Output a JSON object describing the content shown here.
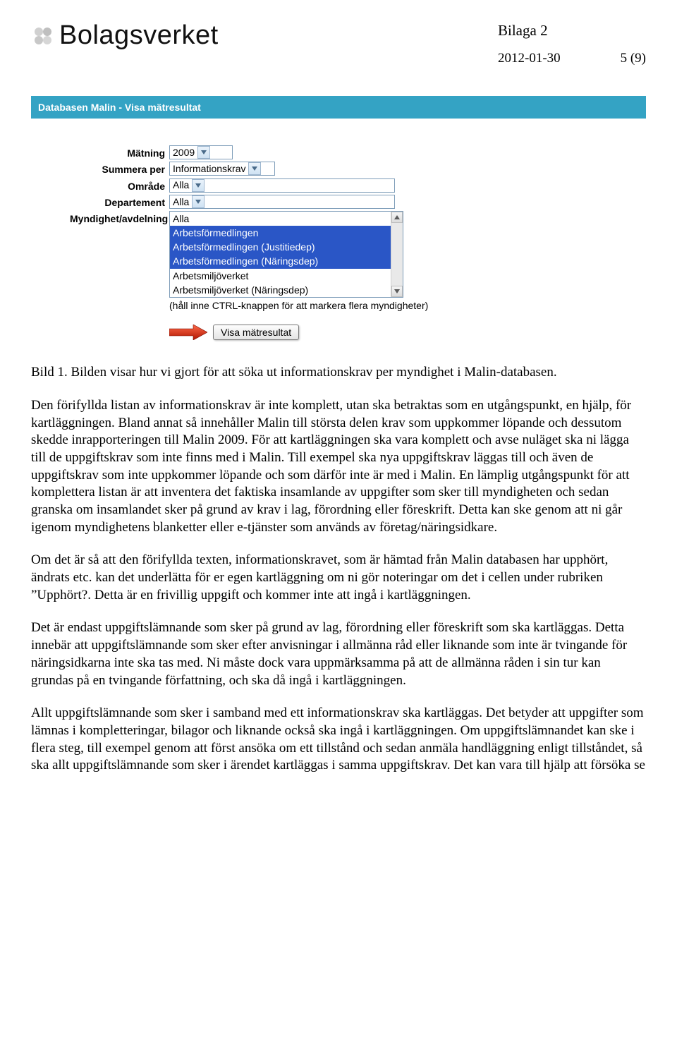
{
  "header": {
    "brand": "Bolagsverket",
    "bilaga": "Bilaga 2",
    "date": "2012-01-30",
    "page_of": "5 (9)"
  },
  "screenshot": {
    "titlebar": "Databasen Malin    -    Visa mätresultat",
    "labels": {
      "matning": "Mätning",
      "summera": "Summera per",
      "omrade": "Område",
      "dept": "Departement",
      "mynd": "Myndighet/avdelning"
    },
    "values": {
      "matning": "2009",
      "summera": "Informationskrav",
      "omrade": "Alla",
      "dept": "Alla"
    },
    "list": {
      "o0": "Alla",
      "o1": "Arbetsförmedlingen",
      "o2": "Arbetsförmedlingen (Justitiedep)",
      "o3": "Arbetsförmedlingen (Näringsdep)",
      "o4": "Arbetsmiljöverket",
      "o5": "Arbetsmiljöverket (Näringsdep)"
    },
    "hint": "(håll inne CTRL-knappen för att markera flera myndigheter)",
    "button": "Visa mätresultat"
  },
  "paragraphs": {
    "caption": "Bild 1. Bilden visar hur vi gjort för att söka ut informationskrav per myndighet i Malin-databasen.",
    "p1": "Den förifyllda listan av informationskrav är inte komplett, utan ska betraktas som en utgångspunkt, en hjälp, för kartläggningen. Bland annat så innehåller Malin till största delen krav som uppkommer löpande och dessutom skedde inrapporteringen till Malin 2009. För att kartläggningen ska vara komplett och avse nuläget ska ni lägga till de uppgiftskrav som inte finns med i Malin. Till exempel ska nya uppgiftskrav läggas till och även de uppgiftskrav som inte uppkommer löpande och som därför inte är med i Malin. En lämplig utgångspunkt för att komplettera listan är att inventera det faktiska insamlande av uppgifter som sker till myndigheten och sedan granska om insamlandet sker på grund av krav i lag, förordning eller föreskrift. Detta kan ske genom att ni går igenom myndighetens blanketter eller e-tjänster som används av företag/näringsidkare.",
    "p2": "Om det är så att den förifyllda texten, informationskravet, som är hämtad från Malin databasen har upphört, ändrats etc. kan det underlätta för er egen kartläggning om ni gör noteringar om det i cellen under rubriken ”Upphört?. Detta är en frivillig uppgift och kommer inte att ingå i kartläggningen.",
    "p3": "Det är endast uppgiftslämnande som sker på grund av lag, förordning eller föreskrift som ska kartläggas. Detta innebär att uppgiftslämnande som sker efter anvisningar i allmänna råd eller liknande som inte är tvingande för näringsidkarna inte ska tas med. Ni måste dock vara uppmärksamma på att de allmänna råden i sin tur kan grundas på en tvingande författning, och ska då ingå i kartläggningen.",
    "p4": "Allt uppgiftslämnande som sker i samband med ett informationskrav ska kartläggas. Det betyder att uppgifter som lämnas i kompletteringar, bilagor och liknande också ska ingå i kartläggningen. Om uppgiftslämnandet kan ske i flera steg, till exempel genom att först ansöka om ett tillstånd och sedan anmäla handläggning enligt tillståndet, så ska allt uppgiftslämnande som sker i ärendet kartläggas i samma uppgiftskrav. Det kan vara till hjälp att försöka se"
  }
}
